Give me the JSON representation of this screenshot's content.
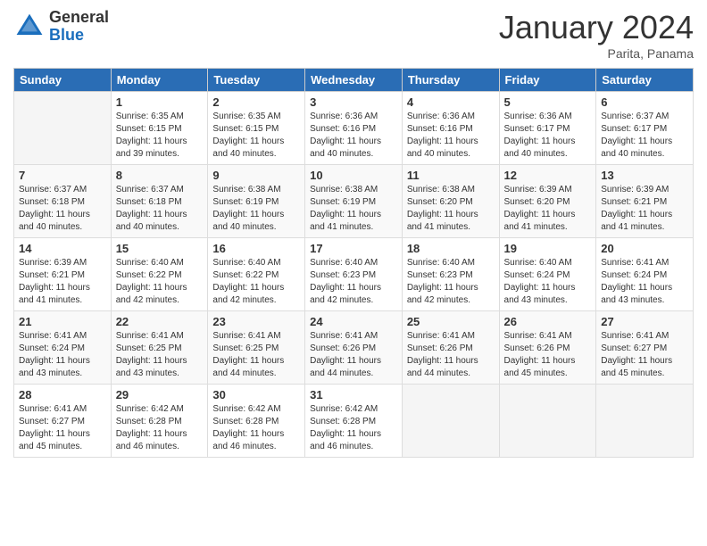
{
  "header": {
    "logo_general": "General",
    "logo_blue": "Blue",
    "month_title": "January 2024",
    "location": "Parita, Panama"
  },
  "days_of_week": [
    "Sunday",
    "Monday",
    "Tuesday",
    "Wednesday",
    "Thursday",
    "Friday",
    "Saturday"
  ],
  "weeks": [
    [
      {
        "day": "",
        "info": ""
      },
      {
        "day": "1",
        "info": "Sunrise: 6:35 AM\nSunset: 6:15 PM\nDaylight: 11 hours\nand 39 minutes."
      },
      {
        "day": "2",
        "info": "Sunrise: 6:35 AM\nSunset: 6:15 PM\nDaylight: 11 hours\nand 40 minutes."
      },
      {
        "day": "3",
        "info": "Sunrise: 6:36 AM\nSunset: 6:16 PM\nDaylight: 11 hours\nand 40 minutes."
      },
      {
        "day": "4",
        "info": "Sunrise: 6:36 AM\nSunset: 6:16 PM\nDaylight: 11 hours\nand 40 minutes."
      },
      {
        "day": "5",
        "info": "Sunrise: 6:36 AM\nSunset: 6:17 PM\nDaylight: 11 hours\nand 40 minutes."
      },
      {
        "day": "6",
        "info": "Sunrise: 6:37 AM\nSunset: 6:17 PM\nDaylight: 11 hours\nand 40 minutes."
      }
    ],
    [
      {
        "day": "7",
        "info": "Sunrise: 6:37 AM\nSunset: 6:18 PM\nDaylight: 11 hours\nand 40 minutes."
      },
      {
        "day": "8",
        "info": "Sunrise: 6:37 AM\nSunset: 6:18 PM\nDaylight: 11 hours\nand 40 minutes."
      },
      {
        "day": "9",
        "info": "Sunrise: 6:38 AM\nSunset: 6:19 PM\nDaylight: 11 hours\nand 40 minutes."
      },
      {
        "day": "10",
        "info": "Sunrise: 6:38 AM\nSunset: 6:19 PM\nDaylight: 11 hours\nand 41 minutes."
      },
      {
        "day": "11",
        "info": "Sunrise: 6:38 AM\nSunset: 6:20 PM\nDaylight: 11 hours\nand 41 minutes."
      },
      {
        "day": "12",
        "info": "Sunrise: 6:39 AM\nSunset: 6:20 PM\nDaylight: 11 hours\nand 41 minutes."
      },
      {
        "day": "13",
        "info": "Sunrise: 6:39 AM\nSunset: 6:21 PM\nDaylight: 11 hours\nand 41 minutes."
      }
    ],
    [
      {
        "day": "14",
        "info": "Sunrise: 6:39 AM\nSunset: 6:21 PM\nDaylight: 11 hours\nand 41 minutes."
      },
      {
        "day": "15",
        "info": "Sunrise: 6:40 AM\nSunset: 6:22 PM\nDaylight: 11 hours\nand 42 minutes."
      },
      {
        "day": "16",
        "info": "Sunrise: 6:40 AM\nSunset: 6:22 PM\nDaylight: 11 hours\nand 42 minutes."
      },
      {
        "day": "17",
        "info": "Sunrise: 6:40 AM\nSunset: 6:23 PM\nDaylight: 11 hours\nand 42 minutes."
      },
      {
        "day": "18",
        "info": "Sunrise: 6:40 AM\nSunset: 6:23 PM\nDaylight: 11 hours\nand 42 minutes."
      },
      {
        "day": "19",
        "info": "Sunrise: 6:40 AM\nSunset: 6:24 PM\nDaylight: 11 hours\nand 43 minutes."
      },
      {
        "day": "20",
        "info": "Sunrise: 6:41 AM\nSunset: 6:24 PM\nDaylight: 11 hours\nand 43 minutes."
      }
    ],
    [
      {
        "day": "21",
        "info": "Sunrise: 6:41 AM\nSunset: 6:24 PM\nDaylight: 11 hours\nand 43 minutes."
      },
      {
        "day": "22",
        "info": "Sunrise: 6:41 AM\nSunset: 6:25 PM\nDaylight: 11 hours\nand 43 minutes."
      },
      {
        "day": "23",
        "info": "Sunrise: 6:41 AM\nSunset: 6:25 PM\nDaylight: 11 hours\nand 44 minutes."
      },
      {
        "day": "24",
        "info": "Sunrise: 6:41 AM\nSunset: 6:26 PM\nDaylight: 11 hours\nand 44 minutes."
      },
      {
        "day": "25",
        "info": "Sunrise: 6:41 AM\nSunset: 6:26 PM\nDaylight: 11 hours\nand 44 minutes."
      },
      {
        "day": "26",
        "info": "Sunrise: 6:41 AM\nSunset: 6:26 PM\nDaylight: 11 hours\nand 45 minutes."
      },
      {
        "day": "27",
        "info": "Sunrise: 6:41 AM\nSunset: 6:27 PM\nDaylight: 11 hours\nand 45 minutes."
      }
    ],
    [
      {
        "day": "28",
        "info": "Sunrise: 6:41 AM\nSunset: 6:27 PM\nDaylight: 11 hours\nand 45 minutes."
      },
      {
        "day": "29",
        "info": "Sunrise: 6:42 AM\nSunset: 6:28 PM\nDaylight: 11 hours\nand 46 minutes."
      },
      {
        "day": "30",
        "info": "Sunrise: 6:42 AM\nSunset: 6:28 PM\nDaylight: 11 hours\nand 46 minutes."
      },
      {
        "day": "31",
        "info": "Sunrise: 6:42 AM\nSunset: 6:28 PM\nDaylight: 11 hours\nand 46 minutes."
      },
      {
        "day": "",
        "info": ""
      },
      {
        "day": "",
        "info": ""
      },
      {
        "day": "",
        "info": ""
      }
    ]
  ]
}
